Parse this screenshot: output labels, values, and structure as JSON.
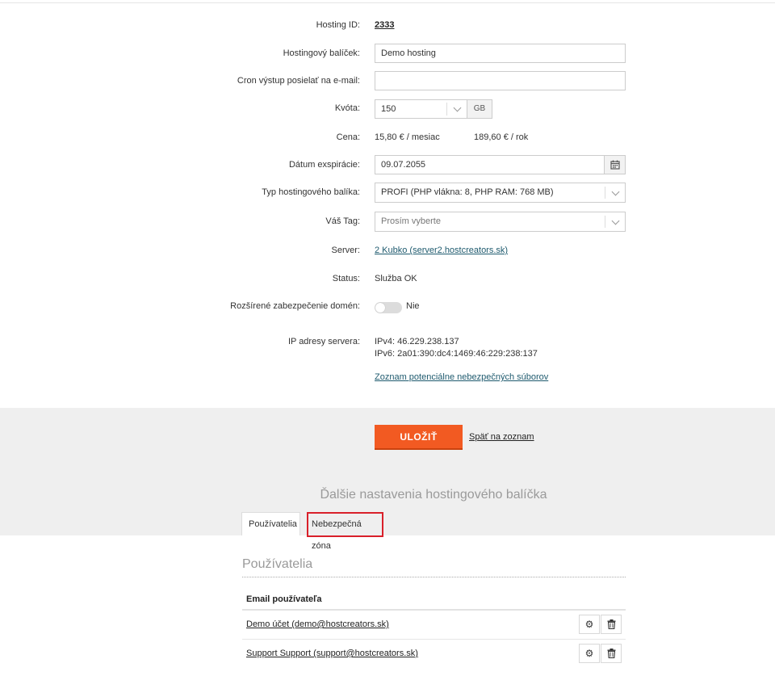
{
  "form": {
    "hosting_id_label": "Hosting ID:",
    "hosting_id_value": "2333",
    "package_label": "Hostingový balíček:",
    "package_value": "Demo hosting",
    "cron_label": "Cron výstup posielať na e-mail:",
    "cron_value": "",
    "quota_label": "Kvóta:",
    "quota_value": "150",
    "quota_unit": "GB",
    "price_label": "Cena:",
    "price_month": "15,80 € / mesiac",
    "price_year": "189,60 € / rok",
    "expiry_label": "Dátum exspirácie:",
    "expiry_value": "09.07.2055",
    "type_label": "Typ hostingového balíka:",
    "type_value": "PROFI (PHP vlákna: 8, PHP RAM: 768 MB)",
    "tag_label": "Váš Tag:",
    "tag_placeholder": "Prosím vyberte",
    "server_label": "Server:",
    "server_value": "2 Kubko (server2.hostcreators.sk)",
    "status_label": "Status:",
    "status_value": "Služba OK",
    "security_label": "Rozšírené zabezpečenie domén:",
    "security_value": "Nie",
    "ip_label": "IP adresy servera:",
    "ipv4": "IPv4: 46.229.238.137",
    "ipv6": "IPv6: 2a01:390:dc4:1469:46:229:238:137",
    "dangerous_files_link": "Zoznam potenciálne nebezpečných súborov"
  },
  "actions": {
    "save_label": "ULOŽIŤ",
    "back_label": "Späť na zoznam"
  },
  "more_settings": {
    "title": "Ďalšie nastavenia hostingového balíčka",
    "tabs": [
      {
        "label": "Používatelia"
      },
      {
        "label": "Nebezpečná zóna"
      }
    ]
  },
  "users": {
    "title": "Používatelia",
    "column_email": "Email používateľa",
    "rows": [
      {
        "email": "Demo účet (demo@hostcreators.sk)"
      },
      {
        "email": "Support Support (support@hostcreators.sk)"
      }
    ]
  },
  "colors": {
    "accent": "#f25a22",
    "highlight": "#d9202a",
    "link": "#1e5a6e"
  }
}
